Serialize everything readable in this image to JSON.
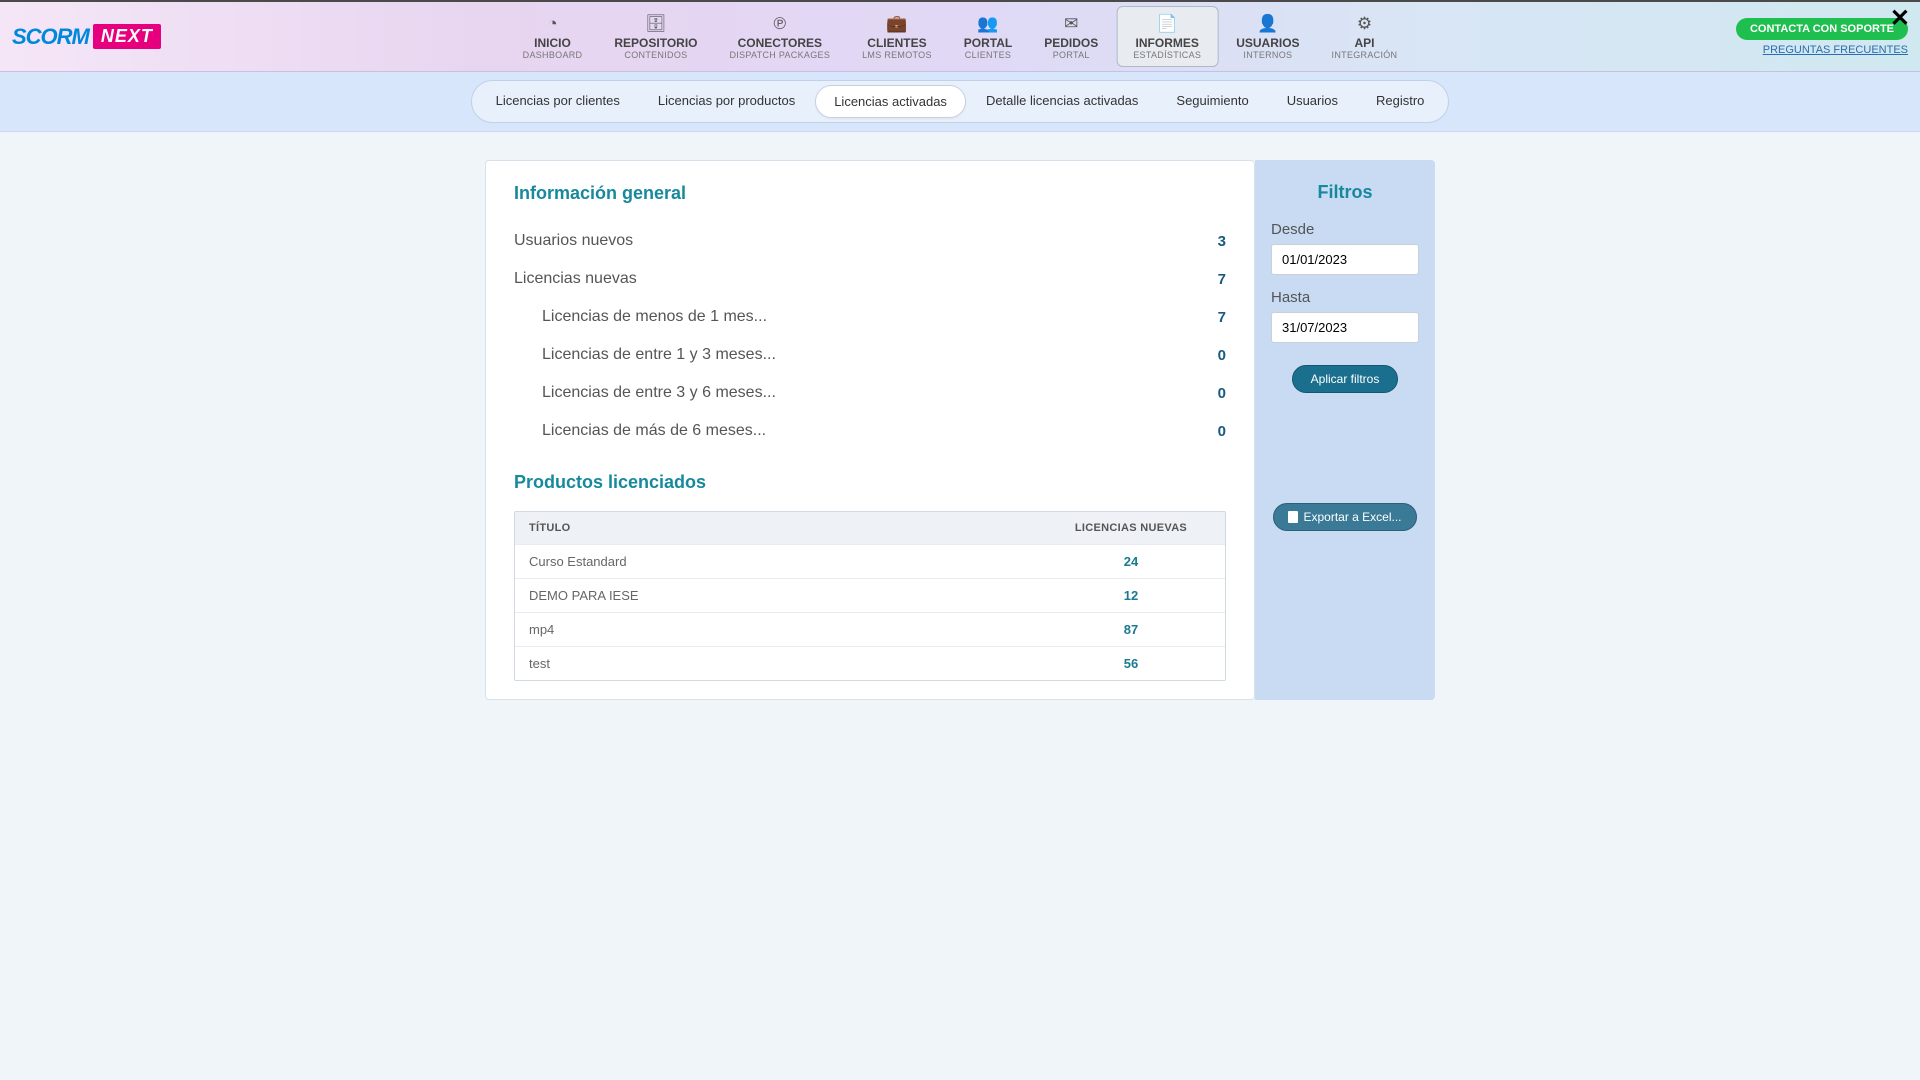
{
  "logo": {
    "part1": "SCORM",
    "part2": "NEXT"
  },
  "close": "✕",
  "header_right": {
    "contact": "CONTACTA CON SOPORTE",
    "faq": "PREGUNTAS FRECUENTES"
  },
  "nav": [
    {
      "icon": "◔",
      "label": "INICIO",
      "sub": "DASHBOARD"
    },
    {
      "icon": "🗄",
      "label": "REPOSITORIO",
      "sub": "CONTENIDOS"
    },
    {
      "icon": "℗",
      "label": "CONECTORES",
      "sub": "DISPATCH PACKAGES"
    },
    {
      "icon": "💼",
      "label": "CLIENTES",
      "sub": "LMS REMOTOS"
    },
    {
      "icon": "👥",
      "label": "PORTAL",
      "sub": "CLIENTES"
    },
    {
      "icon": "✉",
      "label": "PEDIDOS",
      "sub": "PORTAL"
    },
    {
      "icon": "📄",
      "label": "INFORMES",
      "sub": "ESTADÍSTICAS",
      "active": true
    },
    {
      "icon": "👤",
      "label": "USUARIOS",
      "sub": "INTERNOS"
    },
    {
      "icon": "⚙",
      "label": "API",
      "sub": "INTEGRACIÓN"
    }
  ],
  "subnav": [
    {
      "label": "Licencias por clientes"
    },
    {
      "label": "Licencias por productos"
    },
    {
      "label": "Licencias activadas",
      "active": true
    },
    {
      "label": "Detalle licencias activadas"
    },
    {
      "label": "Seguimiento"
    },
    {
      "label": "Usuarios"
    },
    {
      "label": "Registro"
    }
  ],
  "main": {
    "info_title": "Información general",
    "rows": [
      {
        "label": "Usuarios nuevos",
        "value": "3",
        "sub": false
      },
      {
        "label": "Licencias nuevas",
        "value": "7",
        "sub": false
      },
      {
        "label": "Licencias de menos de 1 mes...",
        "value": "7",
        "sub": true
      },
      {
        "label": "Licencias de entre 1 y 3 meses...",
        "value": "0",
        "sub": true
      },
      {
        "label": "Licencias de entre 3 y 6 meses...",
        "value": "0",
        "sub": true
      },
      {
        "label": "Licencias de más de 6 meses...",
        "value": "0",
        "sub": true
      }
    ],
    "products_title": "Productos licenciados",
    "table": {
      "th_title": "TÍTULO",
      "th_lic": "LICENCIAS NUEVAS",
      "rows": [
        {
          "title": "Curso Estandard",
          "lic": "24"
        },
        {
          "title": "DEMO PARA IESE",
          "lic": "12"
        },
        {
          "title": "mp4",
          "lic": "87"
        },
        {
          "title": "test",
          "lic": "56"
        }
      ]
    }
  },
  "filters": {
    "title": "Filtros",
    "from_label": "Desde",
    "from_value": "01/01/2023",
    "to_label": "Hasta",
    "to_value": "31/07/2023",
    "apply": "Aplicar filtros",
    "export": "Exportar a Excel..."
  }
}
